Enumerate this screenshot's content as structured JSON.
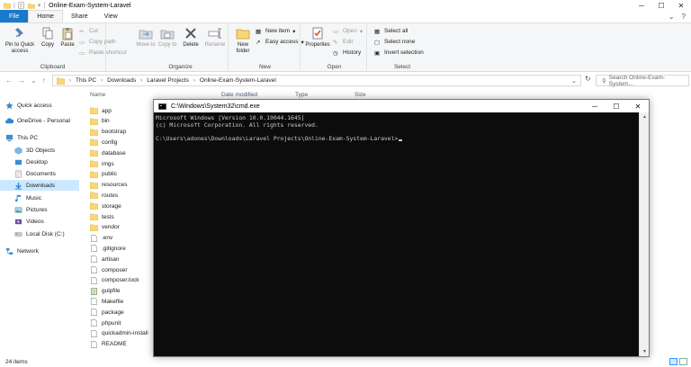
{
  "window": {
    "title": "Online-Exam-System-Laravel"
  },
  "ribbon_tabs": [
    "File",
    "Home",
    "Share",
    "View"
  ],
  "ribbon": {
    "clipboard": {
      "label": "Clipboard",
      "pin_to_quick_access": "Pin to Quick access",
      "copy": "Copy",
      "paste": "Paste",
      "cut": "Cut",
      "copy_path": "Copy path",
      "paste_shortcut": "Paste shortcut"
    },
    "organize": {
      "label": "Organize",
      "move_to": "Move to",
      "copy_to": "Copy to",
      "delete": "Delete",
      "rename": "Rename"
    },
    "new": {
      "label": "New",
      "new_folder": "New folder",
      "new_item": "New item",
      "easy_access": "Easy access"
    },
    "open": {
      "label": "Open",
      "properties": "Properties",
      "open": "Open",
      "edit": "Edit",
      "history": "History"
    },
    "select": {
      "label": "Select",
      "select_all": "Select all",
      "select_none": "Select none",
      "invert_selection": "Invert selection"
    }
  },
  "address": {
    "breadcrumbs": [
      "This PC",
      "Downloads",
      "Laravel Projects",
      "Online-Exam-System-Laravel"
    ],
    "search_placeholder": "Search Online-Exam-System..."
  },
  "nav_pane": {
    "items": [
      {
        "label": "Quick access",
        "icon": "star-icon"
      },
      {
        "label": "OneDrive - Personal",
        "icon": "cloud-icon"
      },
      {
        "label": "This PC",
        "icon": "computer-icon"
      },
      {
        "label": "3D Objects",
        "icon": "cube-icon"
      },
      {
        "label": "Desktop",
        "icon": "desktop-icon"
      },
      {
        "label": "Documents",
        "icon": "document-icon"
      },
      {
        "label": "Downloads",
        "icon": "download-icon"
      },
      {
        "label": "Music",
        "icon": "music-icon"
      },
      {
        "label": "Pictures",
        "icon": "picture-icon"
      },
      {
        "label": "Videos",
        "icon": "video-icon"
      },
      {
        "label": "Local Disk (C:)",
        "icon": "disk-icon"
      },
      {
        "label": "Network",
        "icon": "network-icon"
      }
    ]
  },
  "file_list": {
    "columns": [
      "Name",
      "Date modified",
      "Type",
      "Size"
    ],
    "files": [
      {
        "name": "app",
        "kind": "folder"
      },
      {
        "name": "bin",
        "kind": "folder"
      },
      {
        "name": "bootstrap",
        "kind": "folder"
      },
      {
        "name": "config",
        "kind": "folder"
      },
      {
        "name": "database",
        "kind": "folder"
      },
      {
        "name": "imgs",
        "kind": "folder"
      },
      {
        "name": "public",
        "kind": "folder"
      },
      {
        "name": "resources",
        "kind": "folder"
      },
      {
        "name": "routes",
        "kind": "folder"
      },
      {
        "name": "storage",
        "kind": "folder"
      },
      {
        "name": "tests",
        "kind": "folder"
      },
      {
        "name": "vendor",
        "kind": "folder"
      },
      {
        "name": ".env",
        "kind": "file"
      },
      {
        "name": ".gitignore",
        "kind": "file"
      },
      {
        "name": "artisan",
        "kind": "file"
      },
      {
        "name": "composer",
        "kind": "file"
      },
      {
        "name": "composer.lock",
        "kind": "file"
      },
      {
        "name": "gulpfile",
        "kind": "script"
      },
      {
        "name": "Makefile",
        "kind": "file"
      },
      {
        "name": "package",
        "kind": "file"
      },
      {
        "name": "phpunit",
        "kind": "file"
      },
      {
        "name": "quickadmin-install",
        "kind": "file"
      },
      {
        "name": "README",
        "kind": "file"
      }
    ]
  },
  "status": {
    "item_count": "24 items"
  },
  "cmd": {
    "title": "C:\\Windows\\System32\\cmd.exe",
    "line1": "Microsoft Windows [Version 10.0.19044.1645]",
    "line2": "(c) Microsoft Corporation. All rights reserved.",
    "prompt": "C:\\Users\\adones\\Downloads\\Laravel Projects\\Online-Exam-System-Laravel>"
  },
  "colors": {
    "file_tab": "#1979ca",
    "folder": "#f8d775",
    "selected_nav": "#cce8ff",
    "cmd_bg": "#0c0c0c",
    "cmd_text": "#cccccc"
  }
}
